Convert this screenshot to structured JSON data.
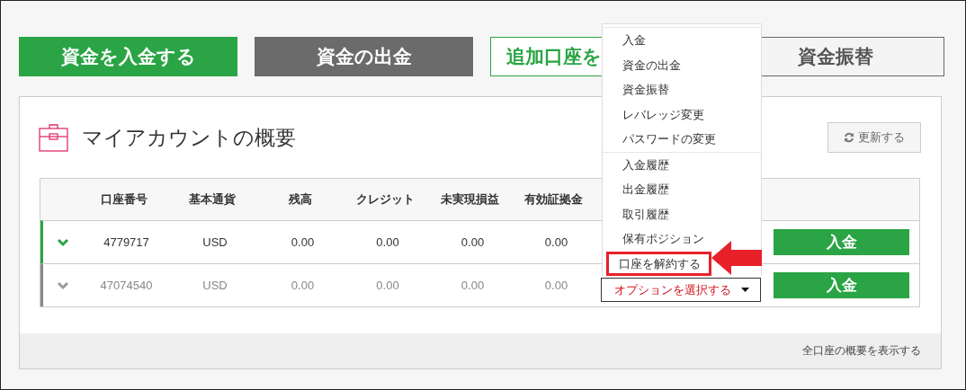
{
  "action_buttons": [
    {
      "label": "資金を入金する",
      "kind": "primary"
    },
    {
      "label": "資金の出金",
      "kind": "secondary"
    },
    {
      "label": "追加口座を",
      "kind": "outline"
    },
    {
      "label": "資金振替",
      "kind": "neutral"
    }
  ],
  "overview": {
    "title": "マイアカウントの概要",
    "refresh_button": "更新する",
    "table": {
      "columns": [
        "口座番号",
        "基本通貨",
        "残高",
        "クレジット",
        "未実現損益",
        "有効証拠金"
      ],
      "rows": [
        {
          "active": true,
          "cells": [
            "4779717",
            "USD",
            "0.00",
            "0.00",
            "0.00",
            "0.00"
          ],
          "deposit_button": "入金"
        },
        {
          "active": false,
          "cells": [
            "47074540",
            "USD",
            "0.00",
            "0.00",
            "0.00",
            "0.00"
          ],
          "option_select": "オプションを選択する",
          "deposit_button": "入金"
        }
      ]
    },
    "footer_link": "全口座の概要を表示する"
  },
  "options_menu": {
    "groups": [
      [
        {
          "label": "入金",
          "highlighted": false
        },
        {
          "label": "資金の出金",
          "highlighted": false
        },
        {
          "label": "資金振替",
          "highlighted": false
        },
        {
          "label": "レバレッジ変更",
          "highlighted": false
        },
        {
          "label": "パスワードの変更",
          "highlighted": false
        }
      ],
      [
        {
          "label": "入金履歴",
          "highlighted": false
        },
        {
          "label": "出金履歴",
          "highlighted": false
        },
        {
          "label": "取引履歴",
          "highlighted": false
        },
        {
          "label": "保有ポジション",
          "highlighted": false
        },
        {
          "label": "口座を解約する",
          "highlighted": true
        }
      ]
    ]
  }
}
